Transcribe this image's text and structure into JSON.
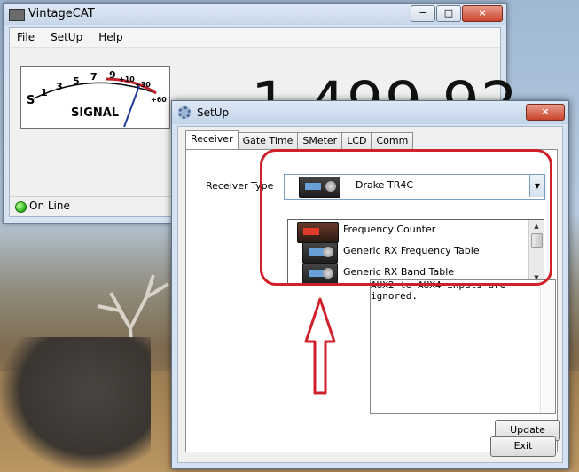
{
  "main_window": {
    "title": "VintageCAT",
    "menu": [
      "File",
      "SetUp",
      "Help"
    ],
    "meter": {
      "scale_labels": [
        "S",
        "1",
        "3",
        "5",
        "7",
        "9",
        "+10",
        "+30",
        "+60"
      ],
      "caption": "SIGNAL"
    },
    "frequency": "1,499.92",
    "status": "On Line"
  },
  "setup_dialog": {
    "title": "SetUp",
    "close_glyph": "×",
    "tabs": [
      "Receiver",
      "Gate Time",
      "SMeter",
      "LCD",
      "Comm"
    ],
    "receiver_type_label": "Receiver Type",
    "selected_receiver": "Drake TR4C",
    "dropdown_items": [
      "Frequency Counter",
      "Generic RX Frequency Table",
      "Generic RX Band Table"
    ],
    "notes_text": "AUX2 to AUX4 inputs are\nignored.",
    "update_button": "Update",
    "exit_button": "Exit"
  },
  "caption_glyphs": {
    "minimize": "−",
    "maximize": "□",
    "close": "×"
  },
  "colors": {
    "annotation": "#d0202a",
    "led": "#26b014"
  }
}
